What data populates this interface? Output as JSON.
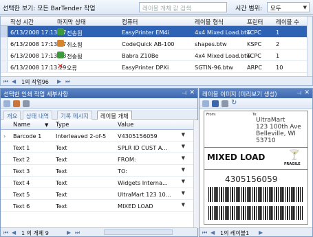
{
  "toolbar": {
    "view_label": "선택한 보기: 모든 BarTender 작업",
    "search_placeholder": "레이블 개체 값 검색",
    "range_label": "시간 범위:",
    "range_value": "모두"
  },
  "jobs": {
    "columns": [
      "작성 시간",
      "마지막 상태",
      "컴퓨터",
      "레이블 형식",
      "프린터",
      "레이블 수"
    ],
    "rows": [
      {
        "time": "6/13/2008 17:13:27",
        "status": "전송됨",
        "computer": "EasyPrinter EM4i",
        "format": "4x4 Mixed Load.btw",
        "printer": "TCPC",
        "count": "1",
        "status_icon": "printed-icon"
      },
      {
        "time": "6/13/2008 17:13:27",
        "status": "취소됨",
        "computer": "CodeQuick AB-100",
        "format": "shapes.btw",
        "printer": "KSPC",
        "count": "2",
        "status_icon": "cancelled-icon"
      },
      {
        "time": "6/13/2008 17:13:28",
        "status": "전송됨",
        "computer": "Babra Z10Be",
        "format": "4x4 Mixed Load.btw",
        "printer": "TCPC",
        "count": "1",
        "status_icon": "printed-icon"
      },
      {
        "time": "6/13/2008 17:13:29",
        "status": "오류",
        "computer": "EasyPrinter DPXi",
        "format": "SGTIN-96.btw",
        "printer": "ARPC",
        "count": "10",
        "status_icon": "error-icon"
      }
    ],
    "nav_text": "1의 작업96"
  },
  "details": {
    "title": "선택한 인쇄 작업 세부사항",
    "tabs": [
      "개요",
      "상태 내역",
      "기록 메시지",
      "레이블 개체"
    ],
    "columns": [
      "Name",
      "Type",
      "Value"
    ],
    "rows": [
      {
        "name": "Barcode 1",
        "type": "Interleaved 2-of-5",
        "value": "V4305156059"
      },
      {
        "name": "Text 1",
        "type": "Text",
        "value": "SPLR ID CUST A..."
      },
      {
        "name": "Text 2",
        "type": "Text",
        "value": "FROM:"
      },
      {
        "name": "Text 3",
        "type": "Text",
        "value": "TO:"
      },
      {
        "name": "Text 4",
        "type": "Text",
        "value": "Widgets Interna..."
      },
      {
        "name": "Text 5",
        "type": "Text",
        "value": "UltraMart 123 10..."
      },
      {
        "name": "Text 6",
        "type": "Text",
        "value": "MIXED LOAD"
      }
    ],
    "nav_text": "1 의 개체 9"
  },
  "preview": {
    "title": "레이블 이미지 (미리보기 생성)",
    "label": {
      "from": "From:",
      "to": "To:",
      "to_address": [
        "UltraMart",
        "123 100th Ave",
        "Belleville, WI",
        "53710"
      ],
      "headline": "MIXED LOAD",
      "fragile": "FRAGILE",
      "barcode_number": "4305156059"
    },
    "nav_text": "1의 레이블1"
  }
}
